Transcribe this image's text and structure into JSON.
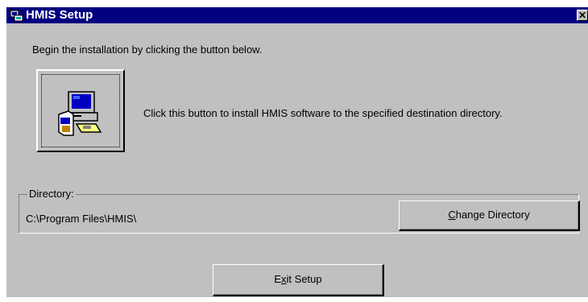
{
  "window": {
    "title": "HMIS Setup",
    "close_symbol": "✕"
  },
  "intro_text": "Begin the installation by clicking the button below.",
  "install": {
    "icon": "computer-install-icon",
    "caption": "Click this button to install HMIS software to the specified destination directory."
  },
  "directory": {
    "legend": "Directory:",
    "path": "C:\\Program Files\\HMIS\\"
  },
  "buttons": {
    "change_directory": {
      "accel": "C",
      "rest": "hange Directory"
    },
    "exit_setup": {
      "pre": "E",
      "accel": "x",
      "rest": "it Setup"
    }
  }
}
